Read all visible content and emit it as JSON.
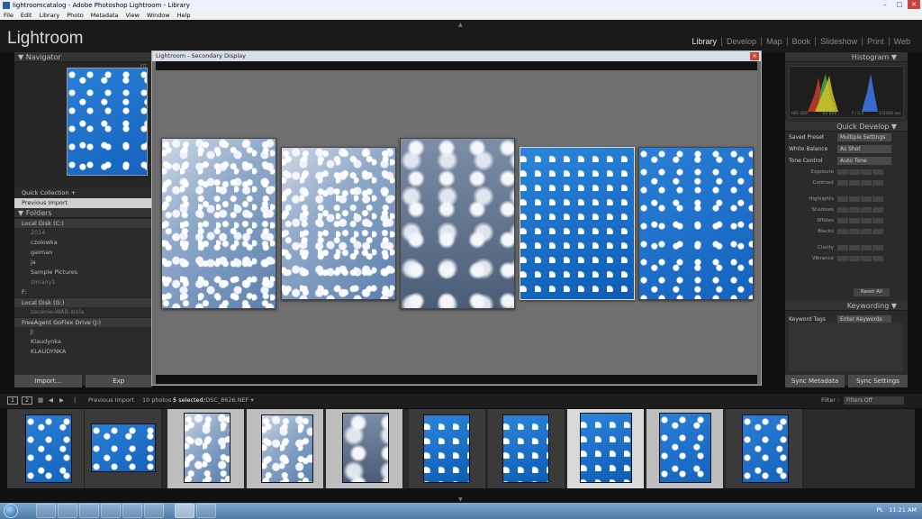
{
  "window": {
    "title": "lightroomcatalog - Adobe Photoshop Lightroom - Library",
    "minimize": "–",
    "maximize": "□",
    "close": "✕"
  },
  "menu": [
    "File",
    "Edit",
    "Library",
    "Photo",
    "Metadata",
    "View",
    "Window",
    "Help"
  ],
  "app": {
    "logo": "Lightroom",
    "modules": [
      "Library",
      "Develop",
      "Map",
      "Book",
      "Slideshow",
      "Print",
      "Web"
    ],
    "active_module": "Library"
  },
  "left_panel": {
    "navigator_label": "Navigator",
    "navigator_fit": "FIT",
    "catalog_rows": [
      "Quick Collection +",
      "Previous Import"
    ],
    "folders_label": "Folders",
    "disks": [
      {
        "name": "Local Disk (C:)",
        "folders": [
          "2014",
          "czolowka",
          "gaiman",
          "ja",
          "Sample Pictures",
          "zmiany1"
        ]
      },
      {
        "name": "Local Disk (G:)",
        "folders": [
          "zecenie-WAB-ziola"
        ]
      },
      {
        "name": "FreeAgent GoFlex Drive (J:)",
        "folders": [
          "J:",
          "Klaudynka",
          "KLAUDYNKA"
        ]
      }
    ],
    "f_drive": "F:",
    "import_label": "Import...",
    "export_label": "Exp"
  },
  "right_panel": {
    "histogram_label": "Histogram",
    "histogram_info": [
      "ISO 320",
      "60 mm",
      "f / 3.5",
      "1/2500 sec"
    ],
    "quick_develop_label": "Quick Develop",
    "saved_preset_label": "Saved Preset",
    "saved_preset_value": "Multiple Settings",
    "white_balance_label": "White Balance",
    "white_balance_value": "As Shot",
    "tone_control_label": "Tone Control",
    "auto_tone_label": "Auto Tone",
    "adjustments": [
      "Exposure",
      "Contrast",
      "Highlights",
      "Shadows",
      "Whites",
      "Blacks",
      "Clarity",
      "Vibrance"
    ],
    "reset_all_label": "Reset All",
    "keywording_label": "Keywording",
    "keyword_tags_label": "Keyword Tags",
    "keyword_tags_value": "Enter Keywords",
    "sync_metadata_label": "Sync Metadata",
    "sync_settings_label": "Sync Settings"
  },
  "secondary_display": {
    "title": "Lightroom - Secondary Display",
    "close": "✕"
  },
  "filmstrip_bar": {
    "display_1": "1",
    "display_2": "2",
    "source": "Previous Import",
    "count": "10 photos /",
    "selected": "5 selected",
    "filename": "/DSC_8626.NEF ▾",
    "filter_label": "Filter :",
    "filter_value": "Filters Off"
  },
  "taskbar": {
    "lang": "PL",
    "time": "11:21 AM"
  },
  "colors": {
    "lr_bg": "#1a1a1a",
    "panel_bg": "#2b2b2b",
    "sky_blue": "#1463bd"
  }
}
